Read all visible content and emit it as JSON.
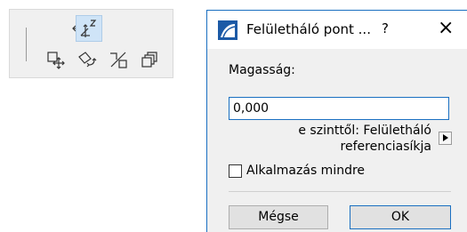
{
  "toolbar": {
    "tools": [
      {
        "icon": "move-cross-icon",
        "state": "normal"
      },
      {
        "icon": "elevate-z-icon",
        "state": "active"
      },
      {
        "icon": "drag-copy-icon",
        "state": "normal"
      },
      {
        "icon": "rotate-copy-icon",
        "state": "normal"
      },
      {
        "icon": "split-icon",
        "state": "normal"
      },
      {
        "icon": "multiply-icon",
        "state": "normal"
      }
    ]
  },
  "dialog": {
    "title": "Felületháló pont ...",
    "help_label": "?",
    "close_label": "×",
    "height_label": "Magasság:",
    "height_value": "0,000",
    "reference_line1": "e szinttől: Felületháló",
    "reference_line2": "referenciasíkja",
    "apply_all_label": "Alkalmazás mindre",
    "apply_all_checked": false,
    "cancel_label": "Mégse",
    "ok_label": "OK"
  },
  "colors": {
    "accent": "#1a6fc1",
    "toolbar_bg": "#f0f0f0",
    "active_tool_bg": "#cfe4f7"
  }
}
